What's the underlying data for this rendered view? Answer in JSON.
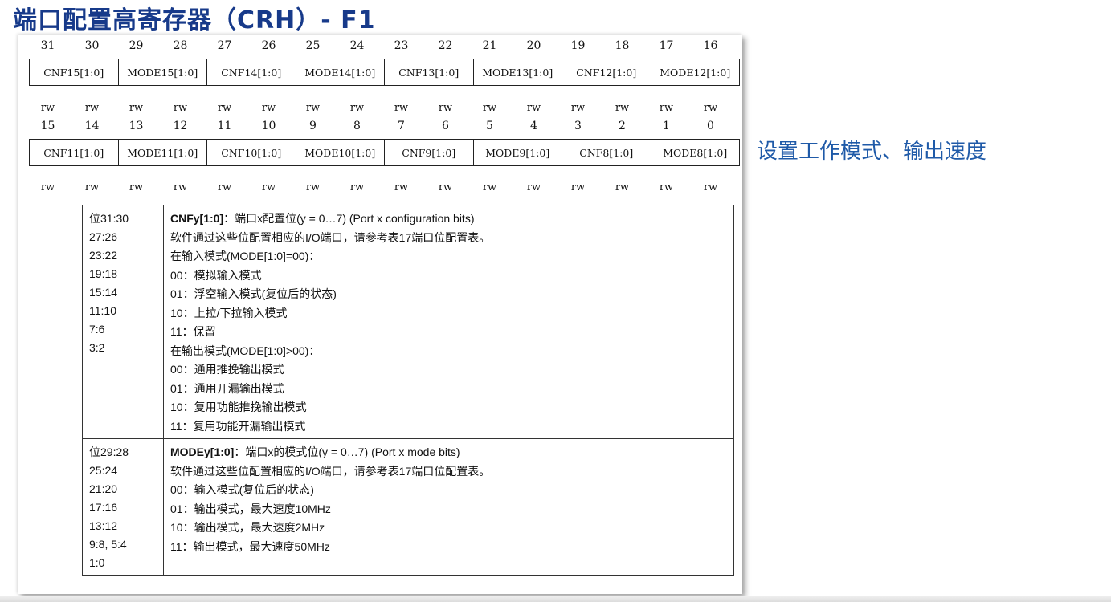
{
  "title": "端口配置高寄存器（CRH）- F1",
  "side_note": "设置工作模式、输出速度",
  "register": {
    "high_bits": [
      "31",
      "30",
      "29",
      "28",
      "27",
      "26",
      "25",
      "24",
      "23",
      "22",
      "21",
      "20",
      "19",
      "18",
      "17",
      "16"
    ],
    "high_fields": [
      "CNF15[1:0]",
      "MODE15[1:0]",
      "CNF14[1:0]",
      "MODE14[1:0]",
      "CNF13[1:0]",
      "MODE13[1:0]",
      "CNF12[1:0]",
      "MODE12[1:0]"
    ],
    "low_bits": [
      "15",
      "14",
      "13",
      "12",
      "11",
      "10",
      "9",
      "8",
      "7",
      "6",
      "5",
      "4",
      "3",
      "2",
      "1",
      "0"
    ],
    "low_fields": [
      "CNF11[1:0]",
      "MODE11[1:0]",
      "CNF10[1:0]",
      "MODE10[1:0]",
      "CNF9[1:0]",
      "MODE9[1:0]",
      "CNF8[1:0]",
      "MODE8[1:0]"
    ],
    "access": "rw"
  },
  "cnf": {
    "bits": [
      "位31:30",
      "27:26",
      "23:22",
      "19:18",
      "15:14",
      "11:10",
      "7:6",
      "3:2"
    ],
    "heading_bold": "CNFy[1:0]",
    "heading_rest": "：端口x配置位(y = 0…7) (Port x configuration bits)",
    "lines": [
      "软件通过这些位配置相应的I/O端口，请参考表17端口位配置表。",
      "在输入模式(MODE[1:0]=00)：",
      "00：模拟输入模式",
      "01：浮空输入模式(复位后的状态)",
      "10：上拉/下拉输入模式",
      "11：保留",
      "在输出模式(MODE[1:0]>00)：",
      "00：通用推挽输出模式",
      "01：通用开漏输出模式",
      "10：复用功能推挽输出模式",
      "11：复用功能开漏输出模式"
    ]
  },
  "mode": {
    "bits": [
      "位29:28",
      "25:24",
      "21:20",
      "17:16",
      "13:12",
      "9:8, 5:4",
      "1:0"
    ],
    "heading_bold": "MODEy[1:0]",
    "heading_rest": "：端口x的模式位(y = 0…7) (Port x mode bits)",
    "lines": [
      "软件通过这些位配置相应的I/O端口，请参考表17端口位配置表。",
      "00：输入模式(复位后的状态)",
      "01：输出模式，最大速度10MHz",
      "10：输出模式，最大速度2MHz",
      "11：输出模式，最大速度50MHz"
    ]
  }
}
